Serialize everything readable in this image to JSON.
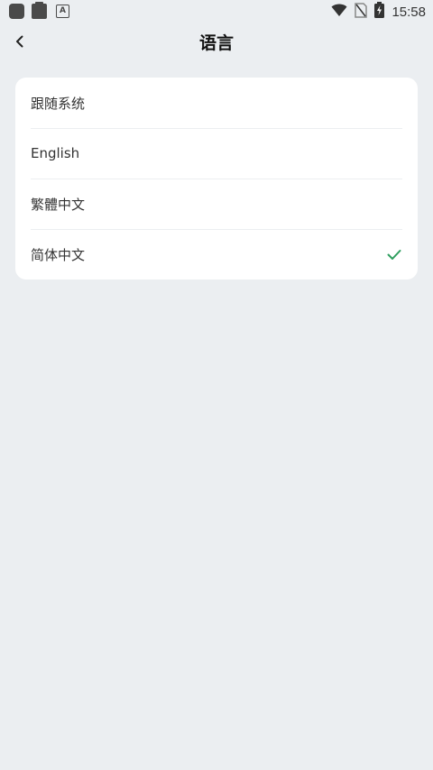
{
  "status_bar": {
    "time": "15:58",
    "icons": [
      "app-icon",
      "clipboard-icon",
      "a-icon",
      "wifi-icon",
      "no-sim-icon",
      "battery-charging-icon"
    ]
  },
  "header": {
    "back_icon": "chevron-left-icon",
    "title": "语言"
  },
  "language_options": [
    {
      "label": "跟随系统",
      "selected": false
    },
    {
      "label": "English",
      "selected": false
    },
    {
      "label": "繁體中文",
      "selected": false
    },
    {
      "label": "简体中文",
      "selected": true
    }
  ],
  "colors": {
    "background": "#ebeef1",
    "card": "#ffffff",
    "check": "#2e9e5e"
  }
}
